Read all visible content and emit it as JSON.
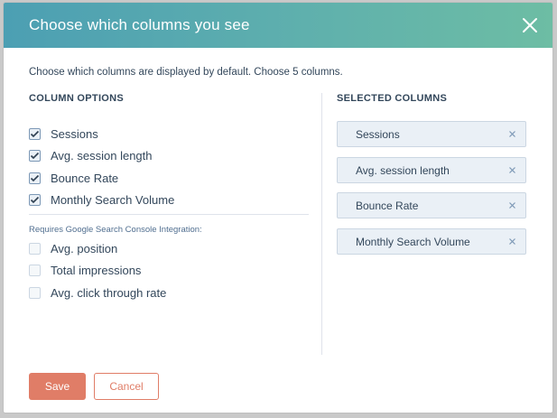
{
  "modal": {
    "title": "Choose which columns you see",
    "instruction": "Choose which columns are displayed by default. Choose 5 columns.",
    "close_icon": "close-icon"
  },
  "column_options": {
    "heading": "COLUMN OPTIONS",
    "items": [
      {
        "label": "Sessions",
        "checked": true
      },
      {
        "label": "Avg. session length",
        "checked": true
      },
      {
        "label": "Bounce Rate",
        "checked": true
      },
      {
        "label": "Monthly Search Volume",
        "checked": true
      }
    ],
    "requires_note": "Requires Google Search Console Integration:",
    "gsc_items": [
      {
        "label": "Avg. position",
        "checked": false
      },
      {
        "label": "Total impressions",
        "checked": false
      },
      {
        "label": "Avg. click through rate",
        "checked": false
      }
    ]
  },
  "selected_columns": {
    "heading": "SELECTED COLUMNS",
    "items": [
      {
        "label": "Sessions"
      },
      {
        "label": "Avg. session length"
      },
      {
        "label": "Bounce Rate"
      },
      {
        "label": "Monthly Search Volume"
      }
    ],
    "remove_icon": "remove-icon"
  },
  "footer": {
    "save_label": "Save",
    "cancel_label": "Cancel"
  },
  "colors": {
    "header_start": "#4c9fb3",
    "header_end": "#6dbda4",
    "accent": "#e07d67",
    "text": "#33475b"
  }
}
